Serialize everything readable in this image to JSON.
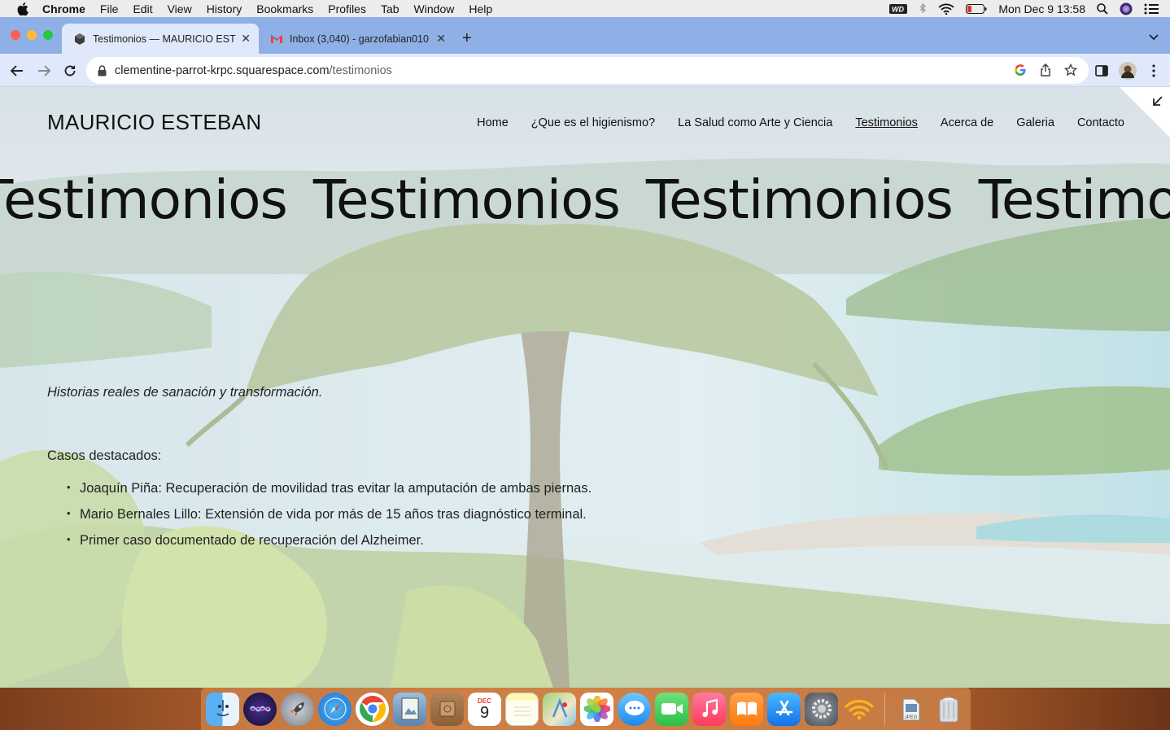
{
  "menubar": {
    "app": "Chrome",
    "items": [
      "File",
      "Edit",
      "View",
      "History",
      "Bookmarks",
      "Profiles",
      "Tab",
      "Window",
      "Help"
    ],
    "clock": "Mon Dec 9  13:58"
  },
  "tabs": [
    {
      "title": "Testimonios — MAURICIO ESTEBAN",
      "active": true
    },
    {
      "title": "Inbox (3,040) - garzofabian010",
      "active": false
    }
  ],
  "toolbar": {
    "url_host": "clementine-parrot-krpc.squarespace.com",
    "url_path": "/testimonios"
  },
  "site": {
    "title": "MAURICIO ESTEBAN",
    "nav": [
      "Home",
      "¿Que es el higienismo?",
      "La Salud como Arte y Ciencia",
      "Testimonios",
      "Acerca de",
      "Galeria",
      "Contacto"
    ],
    "active_nav": "Testimonios",
    "marquee": [
      "Testimonios",
      "Testimonios",
      "Testimonios",
      "Testimonios"
    ],
    "intro": "Historias reales de sanación y transformación.",
    "cases_heading": "Casos destacados:",
    "cases": [
      "Joaquín Piña: Recuperación de movilidad tras evitar la amputación de ambas piernas.",
      "Mario Bernales Lillo: Extensión de vida por más de 15 años tras diagnóstico terminal.",
      "Primer caso documentado de recuperación del Alzheimer."
    ]
  },
  "dock": {
    "calendar_month": "DEC",
    "calendar_day": "9",
    "jpeg_label": "JPEG"
  }
}
